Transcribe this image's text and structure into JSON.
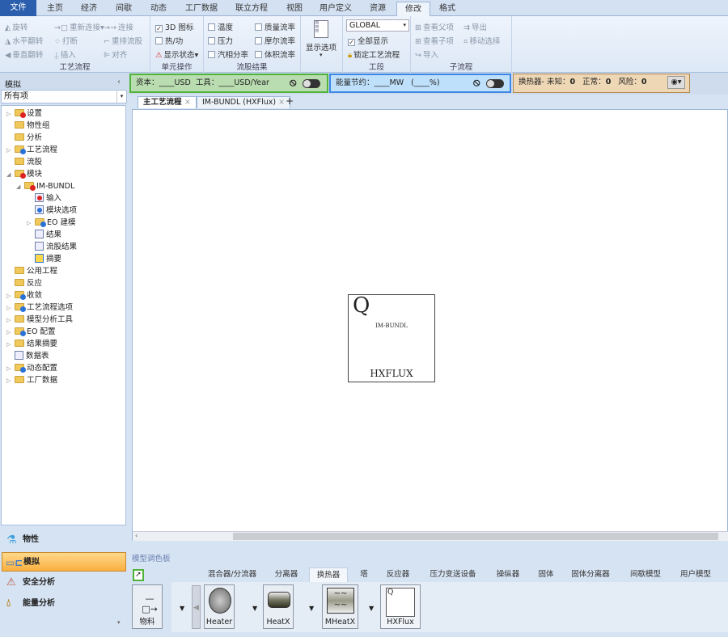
{
  "menu_tabs": [
    "文件",
    "主页",
    "经济",
    "间歇",
    "动态",
    "工厂数据",
    "联立方程",
    "视图",
    "用户定义",
    "资源",
    "修改",
    "格式"
  ],
  "active_menu_tab": "修改",
  "ribbon": {
    "flowsheet": {
      "label": "工艺流程",
      "items": [
        "旋转",
        "水平翻转",
        "垂直翻转",
        "重新连接",
        "打断",
        "插入",
        "连接",
        "重排流股",
        "对齐"
      ]
    },
    "unit_ops": {
      "label": "单元操作",
      "items": [
        "3D 图标",
        "热/功",
        "显示状态"
      ],
      "checked": [
        true,
        false
      ]
    },
    "stream_results": {
      "label": "流股结果",
      "items": [
        "温度",
        "压力",
        "汽相分率",
        "质量流率",
        "摩尔流率",
        "体积流率"
      ]
    },
    "display_options": {
      "label": "显示选项"
    },
    "section": {
      "label": "工段",
      "dropdown": "GLOBAL",
      "show_all": "全部显示",
      "show_all_checked": true,
      "lock": "锁定工艺流程"
    },
    "hierarchy": {
      "label": "子流程",
      "items": [
        "查看父项",
        "查看子项",
        "导入",
        "导出",
        "移动选择"
      ]
    }
  },
  "status": {
    "capital": "资本：____USD  工具：____USD/Year",
    "energy": "能量节约：____MW   (____%)",
    "hx": {
      "prefix": "换热器-",
      "unknown_label": "未知：",
      "unknown": "0",
      "ok_label": "正常：",
      "ok": "0",
      "risk_label": "风险：",
      "risk": "0"
    },
    "colors": {
      "capital": "#b9dcb0",
      "energy": "#bfe0fa",
      "hx": "#eed7b5"
    }
  },
  "left": {
    "title": "模拟",
    "filter": "所有项",
    "tree": [
      {
        "label": "设置",
        "level": 0,
        "exp": "▷",
        "icon": "folder-red"
      },
      {
        "label": "物性组",
        "level": 0,
        "exp": "",
        "icon": "folder"
      },
      {
        "label": "分析",
        "level": 0,
        "exp": "",
        "icon": "folder"
      },
      {
        "label": "工艺流程",
        "level": 0,
        "exp": "▷",
        "icon": "folder-blue"
      },
      {
        "label": "流股",
        "level": 0,
        "exp": "",
        "icon": "folder"
      },
      {
        "label": "模块",
        "level": 0,
        "exp": "◢",
        "icon": "folder-red"
      },
      {
        "label": "IM-BUNDL",
        "level": 1,
        "exp": "◢",
        "icon": "folder-red"
      },
      {
        "label": "输入",
        "level": 2,
        "exp": "",
        "icon": "doc-red"
      },
      {
        "label": "模块选项",
        "level": 2,
        "exp": "",
        "icon": "doc-blue"
      },
      {
        "label": "EO 建模",
        "level": 2,
        "exp": "▷",
        "icon": "folder-blue"
      },
      {
        "label": "结果",
        "level": 2,
        "exp": "",
        "icon": "doc"
      },
      {
        "label": "流股结果",
        "level": 2,
        "exp": "",
        "icon": "doc"
      },
      {
        "label": "摘要",
        "level": 2,
        "exp": "",
        "icon": "doc-check"
      },
      {
        "label": "公用工程",
        "level": 0,
        "exp": "",
        "icon": "folder"
      },
      {
        "label": "反应",
        "level": 0,
        "exp": "",
        "icon": "folder"
      },
      {
        "label": "收敛",
        "level": 0,
        "exp": "▷",
        "icon": "folder-blue"
      },
      {
        "label": "工艺流程选项",
        "level": 0,
        "exp": "▷",
        "icon": "folder-blue"
      },
      {
        "label": "模型分析工具",
        "level": 0,
        "exp": "▷",
        "icon": "folder"
      },
      {
        "label": "EO 配置",
        "level": 0,
        "exp": "▷",
        "icon": "folder-blue"
      },
      {
        "label": "结果摘要",
        "level": 0,
        "exp": "▷",
        "icon": "folder"
      },
      {
        "label": "数据表",
        "level": 0,
        "exp": "",
        "icon": "doc"
      },
      {
        "label": "动态配置",
        "level": 0,
        "exp": "▷",
        "icon": "folder-blue"
      },
      {
        "label": "工厂数据",
        "level": 0,
        "exp": "▷",
        "icon": "folder"
      }
    ],
    "nav": [
      "物性",
      "模拟",
      "安全分析",
      "能量分析"
    ],
    "active_nav": "模拟"
  },
  "doc_tabs": [
    "主工艺流程",
    "IM-BUNDL (HXFlux)"
  ],
  "block": {
    "q": "Q",
    "name": "IM-BUNDL",
    "type": "HXFLUX"
  },
  "palette": {
    "title": "模型调色板",
    "tabs": [
      "混合器/分流器",
      "分离器",
      "换热器",
      "塔",
      "反应器",
      "压力变送设备",
      "操纵器",
      "固体",
      "固体分离器",
      "间歇模型",
      "用户模型"
    ],
    "active_tab": "换热器",
    "stream": "物料",
    "models": [
      "Heater",
      "HeatX",
      "MHeatX",
      "HXFlux"
    ]
  }
}
